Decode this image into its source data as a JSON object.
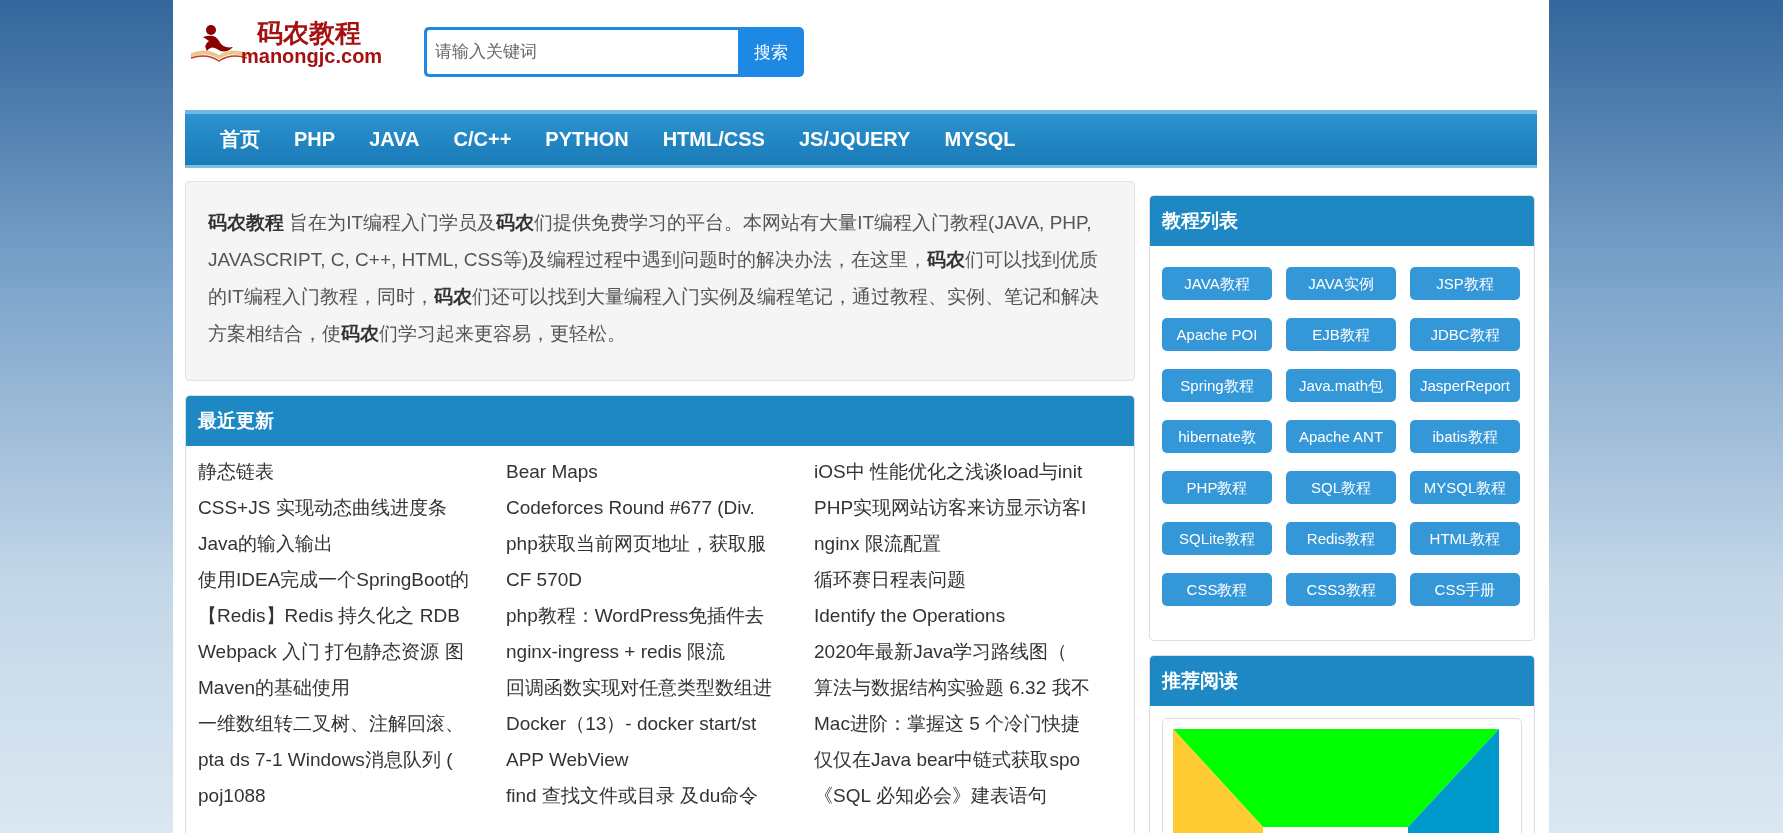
{
  "logo": {
    "title": "码农教程",
    "domain": "manongjc.com"
  },
  "search": {
    "placeholder": "请输入关键词",
    "button": "搜索"
  },
  "nav": [
    {
      "label": "首页",
      "selected": false
    },
    {
      "label": "PHP",
      "selected": false
    },
    {
      "label": "JAVA",
      "selected": false
    },
    {
      "label": "C/C++",
      "selected": false
    },
    {
      "label": "PYTHON",
      "selected": false
    },
    {
      "label": "HTML/CSS",
      "selected": false
    },
    {
      "label": "JS/JQUERY",
      "selected": false
    },
    {
      "label": "MYSQL",
      "selected": false
    }
  ],
  "intro": "**码农教程** 旨在为IT编程入门学员及**码农**们提供免费学习的平台。本网站有大量IT编程入门教程(JAVA, PHP, JAVASCRIPT, C, C++, HTML, CSS等)及编程过程中遇到问题时的解决办法，在这里，**码农**们可以找到优质的IT编程入门教程，同时，**码农**们还可以找到大量编程入门实例及编程笔记，通过教程、实例、笔记和解决方案相结合，使**码农**们学习起来更容易，更轻松。",
  "recent_updates": {
    "title": "最近更新",
    "items": [
      "静态链表",
      "Bear Maps",
      "iOS中 性能优化之浅谈load与init",
      "CSS+JS 实现动态曲线进度条",
      "Codeforces Round #677 (Div.",
      "PHP实现网站访客来访显示访客I",
      "Java的输入输出",
      "php获取当前网页地址，获取服",
      "nginx 限流配置",
      "使用IDEA完成一个SpringBoot的",
      "CF 570D",
      "循环赛日程表问题",
      "【Redis】Redis 持久化之 RDB",
      "php教程：WordPress免插件去",
      "Identify the Operations",
      "Webpack 入门 打包静态资源 图",
      "nginx-ingress + redis 限流",
      "2020年最新Java学习路线图（",
      "Maven的基础使用",
      "回调函数实现对任意类型数组进",
      "算法与数据结构实验题 6.32 我不",
      "一维数组转二叉树、注解回滚、",
      "Docker（13）- docker start/st",
      "Mac进阶：掌握这 5 个冷门快捷",
      "pta ds 7-1 Windows消息队列 (",
      "APP WebView",
      "仅仅在Java bear中链式获取spo",
      "poj1088",
      "find 查找文件或目录 及du命令",
      "《SQL 必知必会》建表语句"
    ]
  },
  "tutorials": {
    "title": "教程列表",
    "items": [
      "JAVA教程",
      "JAVA实例",
      "JSP教程",
      "Apache POI",
      "EJB教程",
      "JDBC教程",
      "Spring教程",
      "Java.math包",
      "JasperReport",
      "hibernate教",
      "Apache ANT",
      "ibatis教程",
      "PHP教程",
      "SQL教程",
      "MYSQL教程",
      "SQLite教程",
      "Redis教程",
      "HTML教程",
      "CSS教程",
      "CSS3教程",
      "CSS手册"
    ]
  },
  "recommended": {
    "title": "推荐阅读",
    "kind": "picture"
  }
}
